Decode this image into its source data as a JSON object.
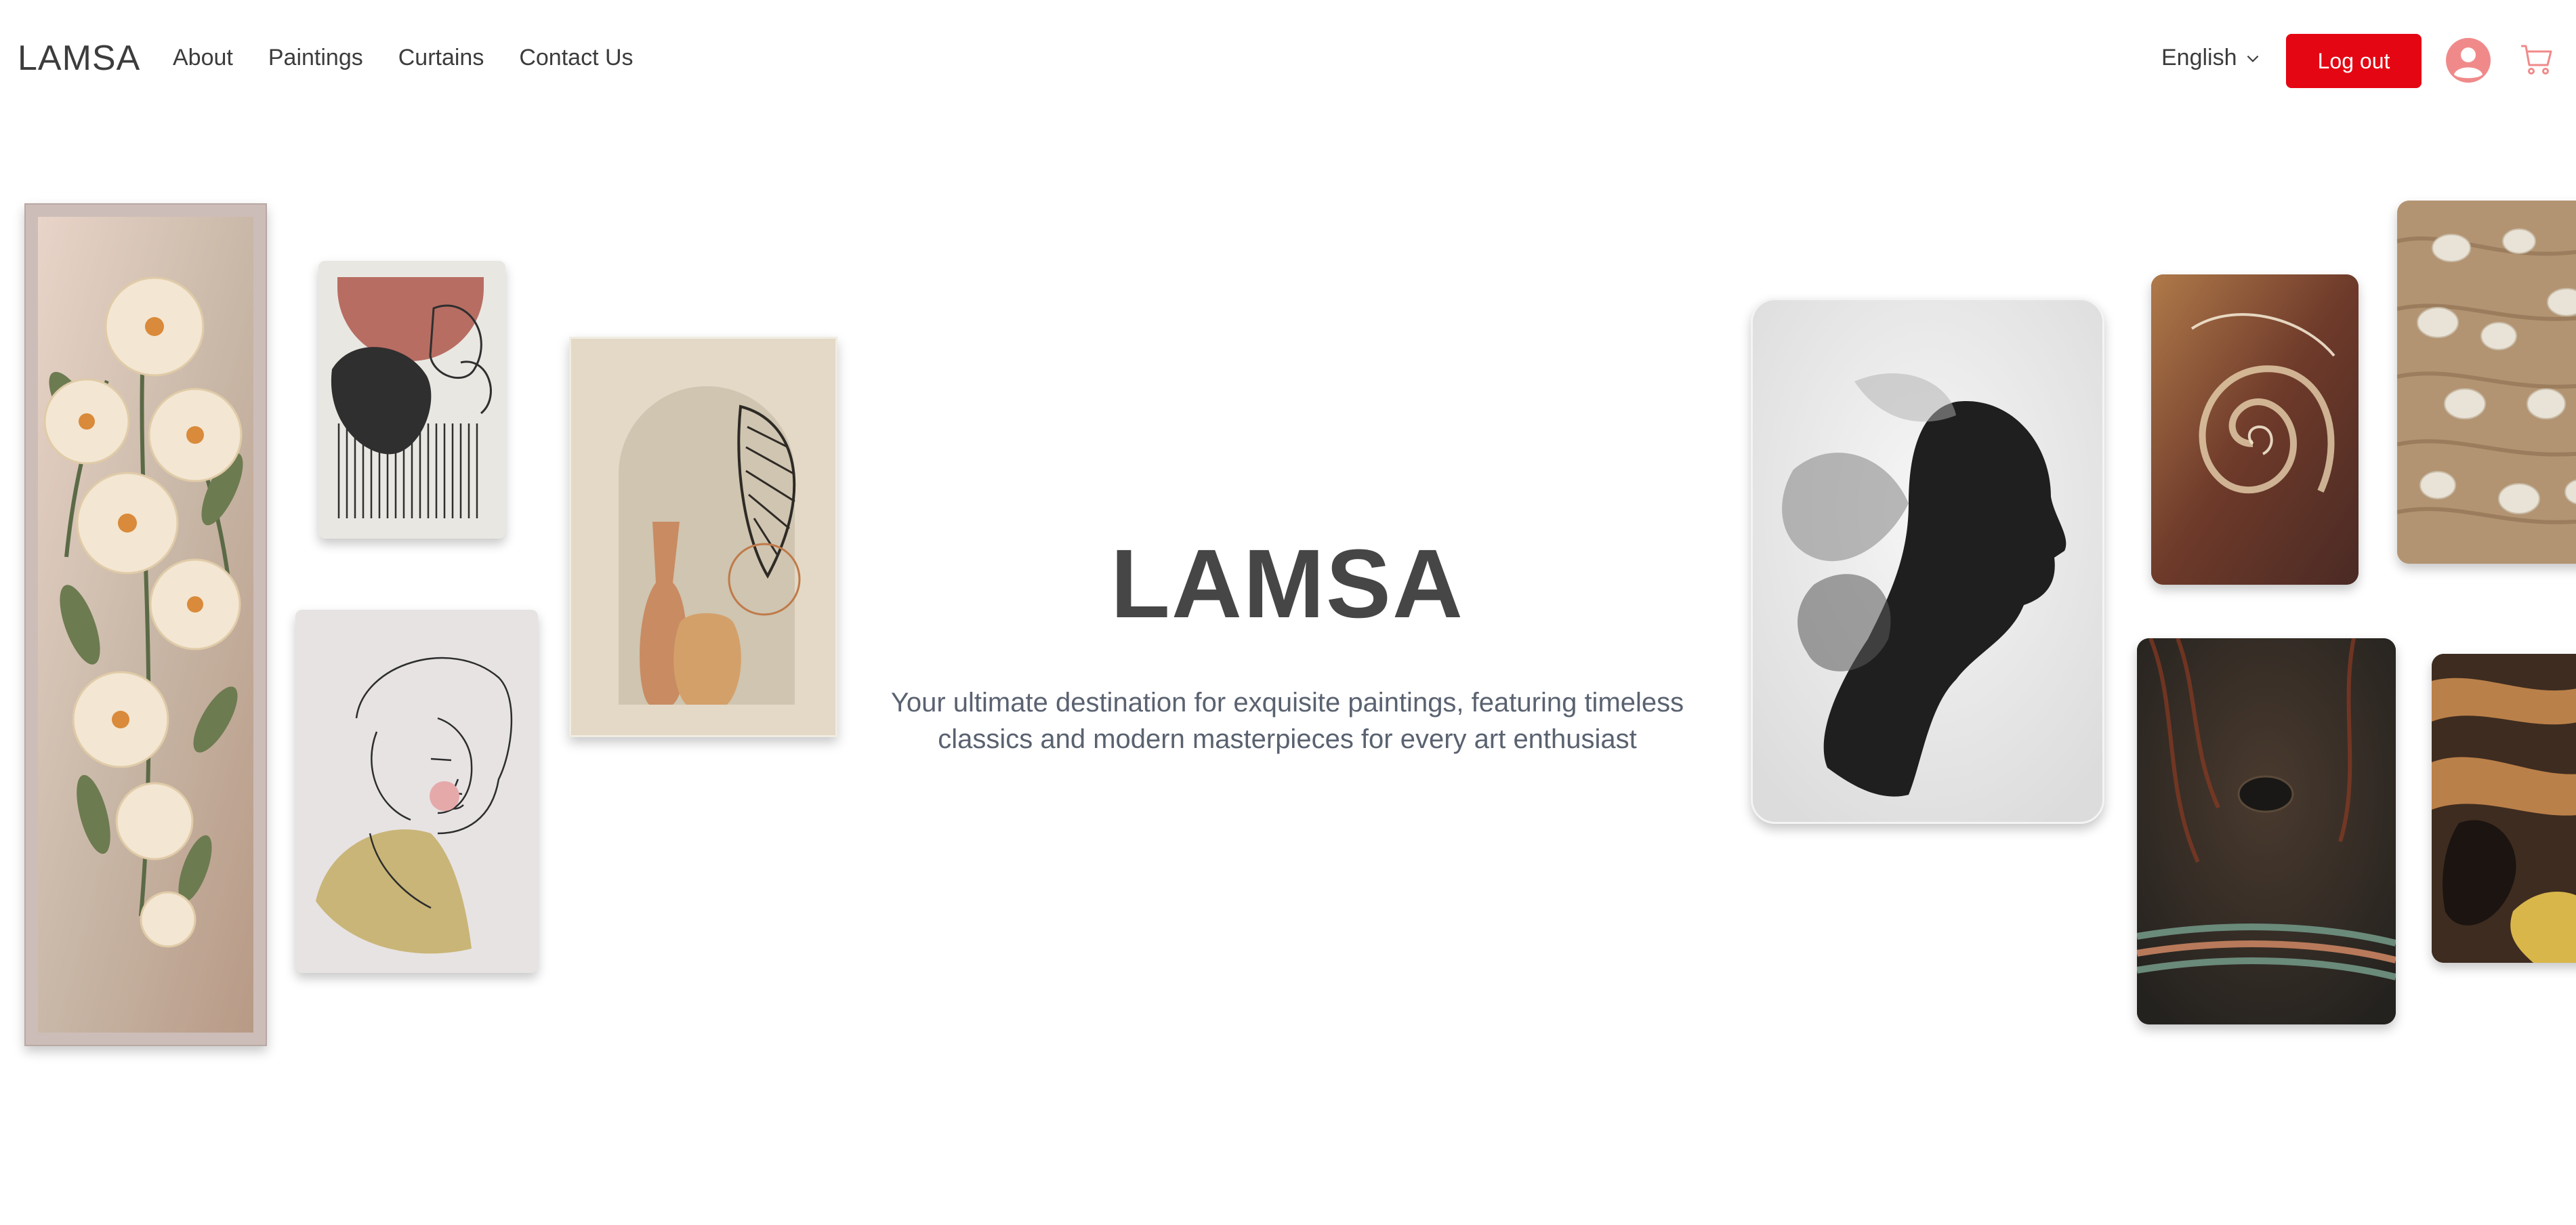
{
  "header": {
    "logo": "LAMSA",
    "nav": [
      "About",
      "Paintings",
      "Curtains",
      "Contact Us"
    ],
    "language": "English",
    "logout_label": "Log out"
  },
  "hero": {
    "title": "LAMSA",
    "subtitle_line1": "Your ultimate destination for exquisite paintings, featuring timeless",
    "subtitle_line2": "classics and modern masterpieces for every art enthusiast"
  },
  "colors": {
    "accent": "#e40613",
    "avatar": "#f08a8a",
    "text": "#3c3c3c",
    "subtitle": "#5a6270"
  },
  "icons": [
    "chevron-down-icon",
    "user-avatar-icon",
    "cart-icon"
  ]
}
